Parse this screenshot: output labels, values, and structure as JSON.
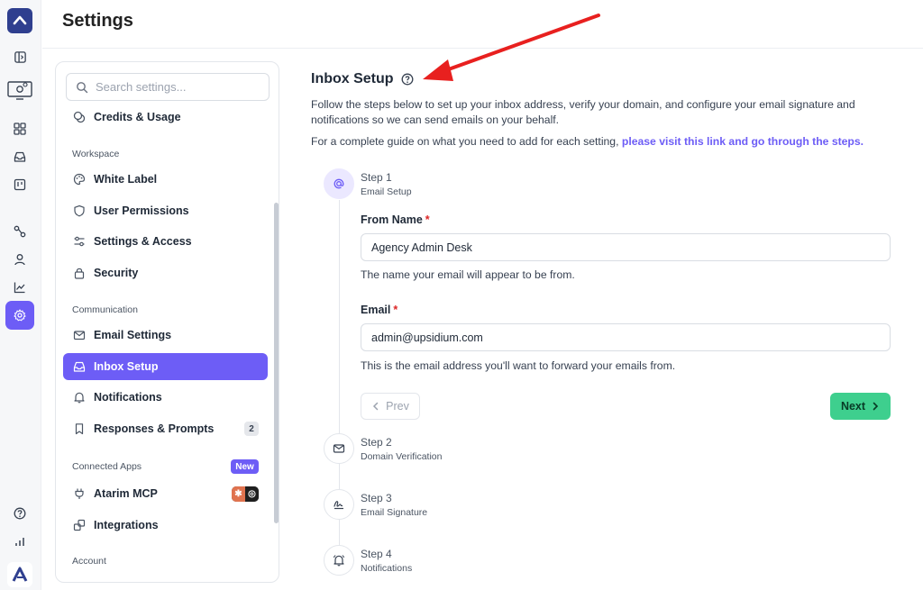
{
  "header": {
    "title": "Settings"
  },
  "search": {
    "placeholder": "Search settings..."
  },
  "nav": {
    "credits": "Credits & Usage",
    "workspace_label": "Workspace",
    "white_label": "White Label",
    "user_permissions": "User Permissions",
    "settings_access": "Settings & Access",
    "security": "Security",
    "communication_label": "Communication",
    "email_settings": "Email Settings",
    "inbox_setup": "Inbox Setup",
    "notifications": "Notifications",
    "responses_prompts": "Responses & Prompts",
    "responses_count": "2",
    "connected_apps_label": "Connected Apps",
    "new_badge": "New",
    "atarim_mcp": "Atarim MCP",
    "integrations": "Integrations",
    "account_label": "Account"
  },
  "content": {
    "title": "Inbox Setup",
    "description": "Follow the steps below to set up your inbox address, verify your domain, and configure your email signature and notifications so we can send emails on your behalf.",
    "guide_prefix": "For a complete guide on what you need to add for each setting,",
    "guide_link": "please visit this link and go through the steps."
  },
  "steps": [
    {
      "title": "Step 1",
      "subtitle": "Email Setup",
      "icon": "at-icon",
      "current": true
    },
    {
      "title": "Step 2",
      "subtitle": "Domain Verification",
      "icon": "envelope-check-icon"
    },
    {
      "title": "Step 3",
      "subtitle": "Email Signature",
      "icon": "signature-icon"
    },
    {
      "title": "Step 4",
      "subtitle": "Notifications",
      "icon": "bell-icon"
    }
  ],
  "form": {
    "from_name_label": "From Name",
    "from_name_value": "Agency Admin Desk",
    "from_name_help": "The name your email will appear to be from.",
    "email_label": "Email",
    "email_value": "admin@upsidium.com",
    "email_help": "This is the email address you'll want to forward your emails from.",
    "required_mark": "*"
  },
  "buttons": {
    "prev": "Prev",
    "next": "Next"
  },
  "colors": {
    "accent": "#6d5df6",
    "success": "#3ecf8e",
    "annotation": "#e8201f"
  }
}
